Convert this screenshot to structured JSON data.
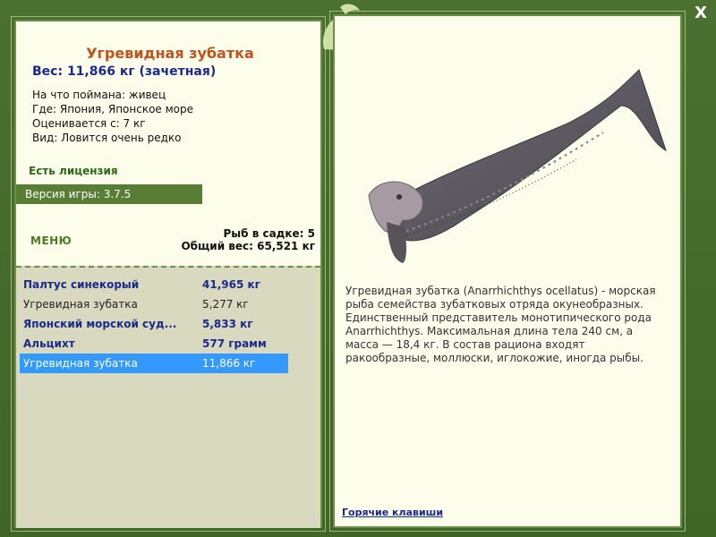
{
  "window": {
    "close_label": "X"
  },
  "catch": {
    "title": "Угревидная зубатка",
    "weight": "Вес: 11,866 кг (зачетная)",
    "bait": "На что поймана: живец",
    "location": "Где: Япония, Японское море",
    "evaluated": "Оценивается с: 7 кг",
    "type": "Вид: Ловится очень редко",
    "license": "Есть лицензия",
    "version": "Версия игры: 3.7.5"
  },
  "menu_label": "МЕНЮ",
  "stats": {
    "fish_count": "Рыб в садке: 5",
    "total_weight": "Общий вес: 65,521 кг"
  },
  "catches": [
    {
      "name": "Палтус синекорый",
      "weight": "41,965 кг"
    },
    {
      "name": "Угревидная зубатка",
      "weight": "5,277 кг"
    },
    {
      "name": "Японский морской суд...",
      "weight": "5,833 кг"
    },
    {
      "name": "Альцихт",
      "weight": "577 грамм"
    },
    {
      "name": "Угревидная зубатка",
      "weight": "11,866 кг"
    }
  ],
  "description": "Угревидная зубатка (Anarrhichthys ocellatus) - морская рыба семейства зубатковых отряда окунеобразных. Единственный представитель монотипического рода Anarrhichthys. Максимальная длина тела 240 см, а масса — 18,4 кг. В состав рациона входят ракообразные, моллюски, иглокожие, иногда рыбы.",
  "hotkeys_label": "Горячие клавиши"
}
